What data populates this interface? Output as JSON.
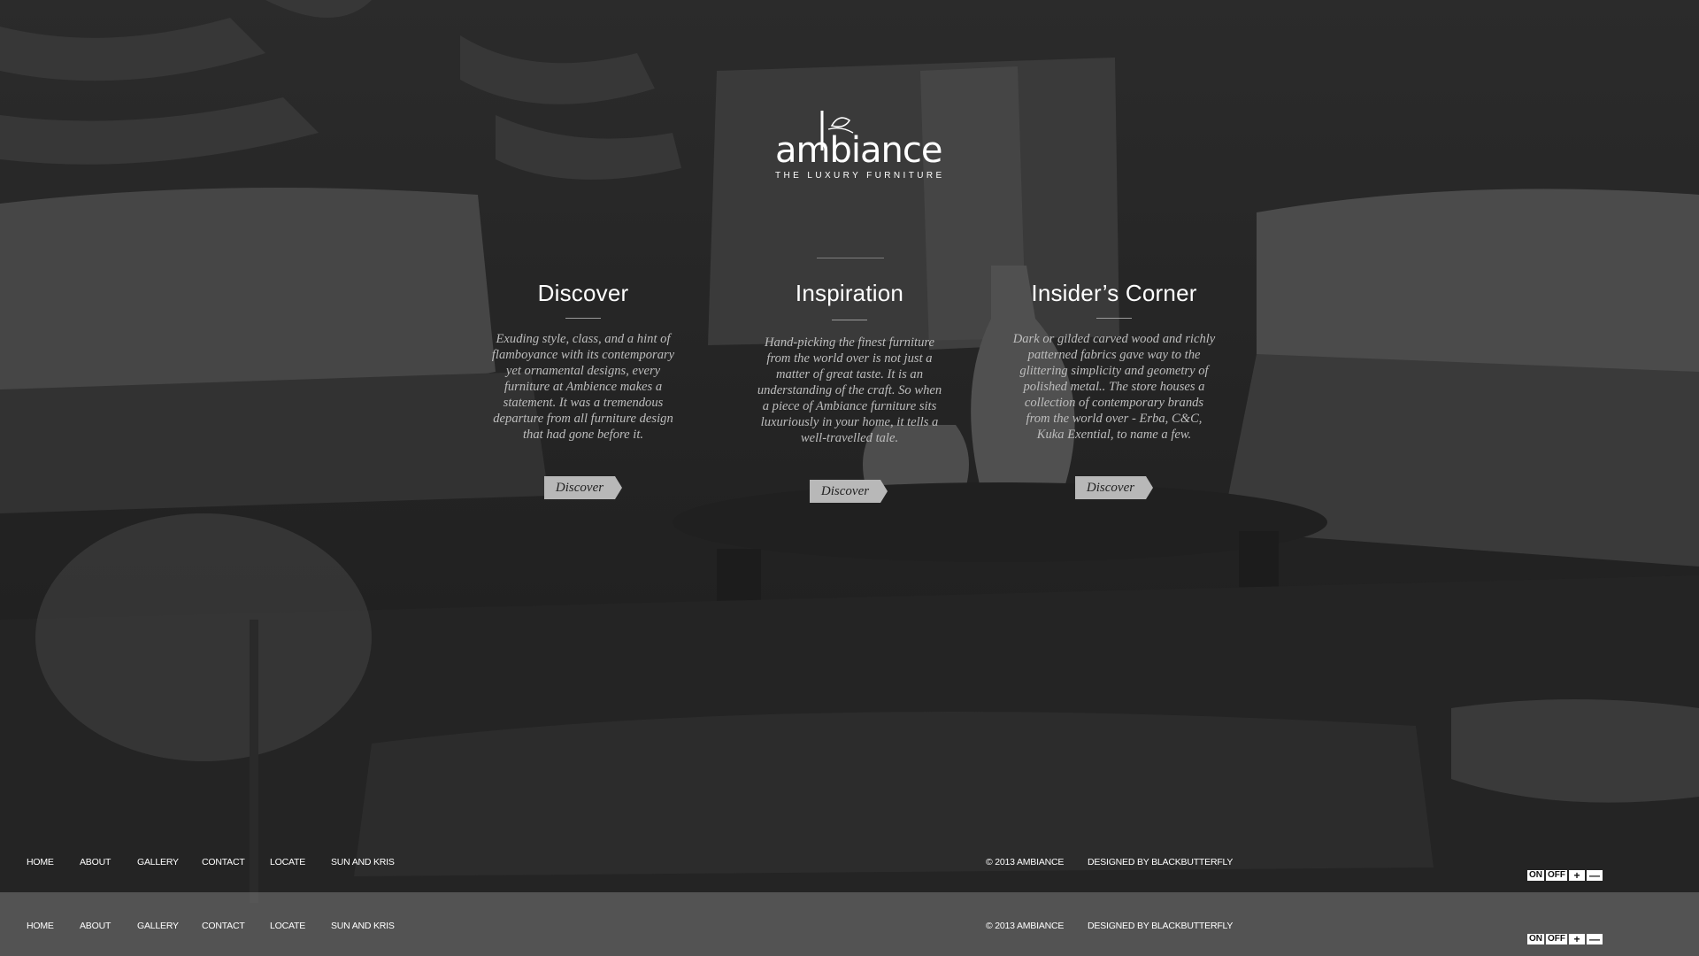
{
  "brand": {
    "name": "ambiance",
    "tagline": "THE LUXURY FURNITURE"
  },
  "columns": [
    {
      "title": "Discover",
      "body": "Exuding style, class, and a hint of flamboyance with its contemporary yet ornamental designs, every furniture at Ambience makes a statement. It was a tremendous departure from all furniture design that had gone before it.",
      "button": "Discover"
    },
    {
      "title": "Inspiration",
      "body": "Hand-picking the finest furniture from the world over is not just a matter of great taste. It is an understanding of the craft. So when a piece of Ambiance furniture sits luxuriously in your home, it tells a well-travelled tale.",
      "button": "Discover"
    },
    {
      "title": "Insider’s Corner",
      "body": "Dark or gilded carved wood and richly patterned fabrics gave way to the glittering simplicity and geometry of polished metal.. The store houses a collection of contemporary brands from the world over - Erba, C&C, Kuka Exential, to name a few.",
      "button": "Discover"
    }
  ],
  "footer": {
    "nav": [
      "HOME",
      "ABOUT",
      "GALLERY",
      "CONTACT",
      "LOCATE",
      "SUN AND KRIS"
    ],
    "copyright": "© 2013 AMBIANCE",
    "credit": "DESIGNED BY BLACKBUTTERFLY"
  },
  "music_controls": {
    "on": "ON",
    "off": "OFF",
    "plus": "+",
    "minus": "—"
  },
  "colors": {
    "background": "#1a1a1a",
    "text": "#ffffff",
    "body_text": "#bdbdbd",
    "button": "#b8b8b8"
  }
}
